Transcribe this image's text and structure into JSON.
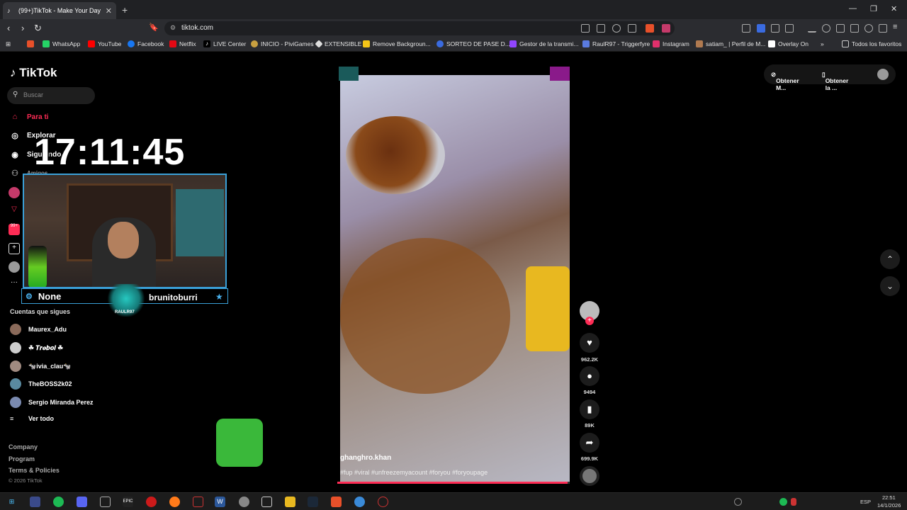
{
  "browser": {
    "tab_title": "(99+)TikTok - Make Your Day",
    "tab_close": "✕",
    "new_tab": "+",
    "window_controls": [
      "—",
      "❐",
      "✕"
    ],
    "url": "tiktok.com",
    "nav_icons": [
      "arrow-left-icon",
      "arrow-right-icon",
      "reload-icon",
      "bookmark-icon"
    ]
  },
  "bookmarks": [
    {
      "label": "WhatsApp",
      "color": "#25d366"
    },
    {
      "label": "YouTube",
      "color": "#ff0000"
    },
    {
      "label": "Facebook",
      "color": "#1877f2"
    },
    {
      "label": "Netflix",
      "color": "#e50914"
    },
    {
      "label": "LIVE Center",
      "color": "#ffffff"
    },
    {
      "label": "INICIO - PiviGames",
      "color": "#444444"
    },
    {
      "label": "EXTENSIBLE",
      "color": "#dddddd"
    },
    {
      "label": "Remove Backgroun...",
      "color": "#f5c518"
    },
    {
      "label": "SORTEO DE PASE D...",
      "color": "#3a6be0"
    },
    {
      "label": "Gestor de la transmi...",
      "color": "#9146ff"
    },
    {
      "label": "RaulR97 - Triggerfyre",
      "color": "#5a7be0"
    },
    {
      "label": "Instagram",
      "color": "#e1306c"
    },
    {
      "label": "satiam_ | Perfil de M...",
      "color": "#b07a50"
    },
    {
      "label": "Overlay On",
      "color": "#ffffff"
    }
  ],
  "bookmarks_more": "»",
  "bookmarks_all": "Todos los favoritos",
  "sidebar": {
    "logo": "TikTok",
    "search_placeholder": "Buscar",
    "nav": [
      {
        "label": "Para ti",
        "icon": "home-icon",
        "active": true
      },
      {
        "label": "Explorar",
        "icon": "compass-icon"
      },
      {
        "label": "Siguiendo",
        "icon": "following-icon"
      }
    ],
    "hidden_label": "Amigos",
    "more_icon": "···",
    "badge": "99+",
    "follows_title": "Cuentas que sigues",
    "accounts": [
      "Maurex_Adu",
      "☘ 𝑻𝒓𝒆𝒃𝒐𝒍 ☘",
      "🐄ivia_clau🐄",
      "TheBOSS2k02",
      "Sergio Miranda Perez"
    ],
    "see_all": "Ver todo",
    "footer_links": [
      "Company",
      "Program",
      "Terms & Policies"
    ],
    "copyright": "© 2026 TikTok"
  },
  "overlay": {
    "clock": "17:11:45",
    "left_name": "None",
    "right_name": "brunitoburri",
    "wolf_text": "RAULR97"
  },
  "video": {
    "username": "ghanghro.khan",
    "hashtags": "#fup #viral #unfreezemyacount #foryou #foryoupage",
    "progress": 0.99
  },
  "actions": {
    "likes": "962.2K",
    "comments": "9494",
    "saves": "89K",
    "shares": "699.9K"
  },
  "top_right": {
    "get_app": "Obtener M...",
    "get_desktop": "Obtener la ..."
  },
  "taskbar": {
    "language": "ESP",
    "time": "22:51",
    "date": "14/1/2026"
  },
  "colors": {
    "accent": "#fe2c55",
    "overlay_border": "#3aa0d8"
  }
}
